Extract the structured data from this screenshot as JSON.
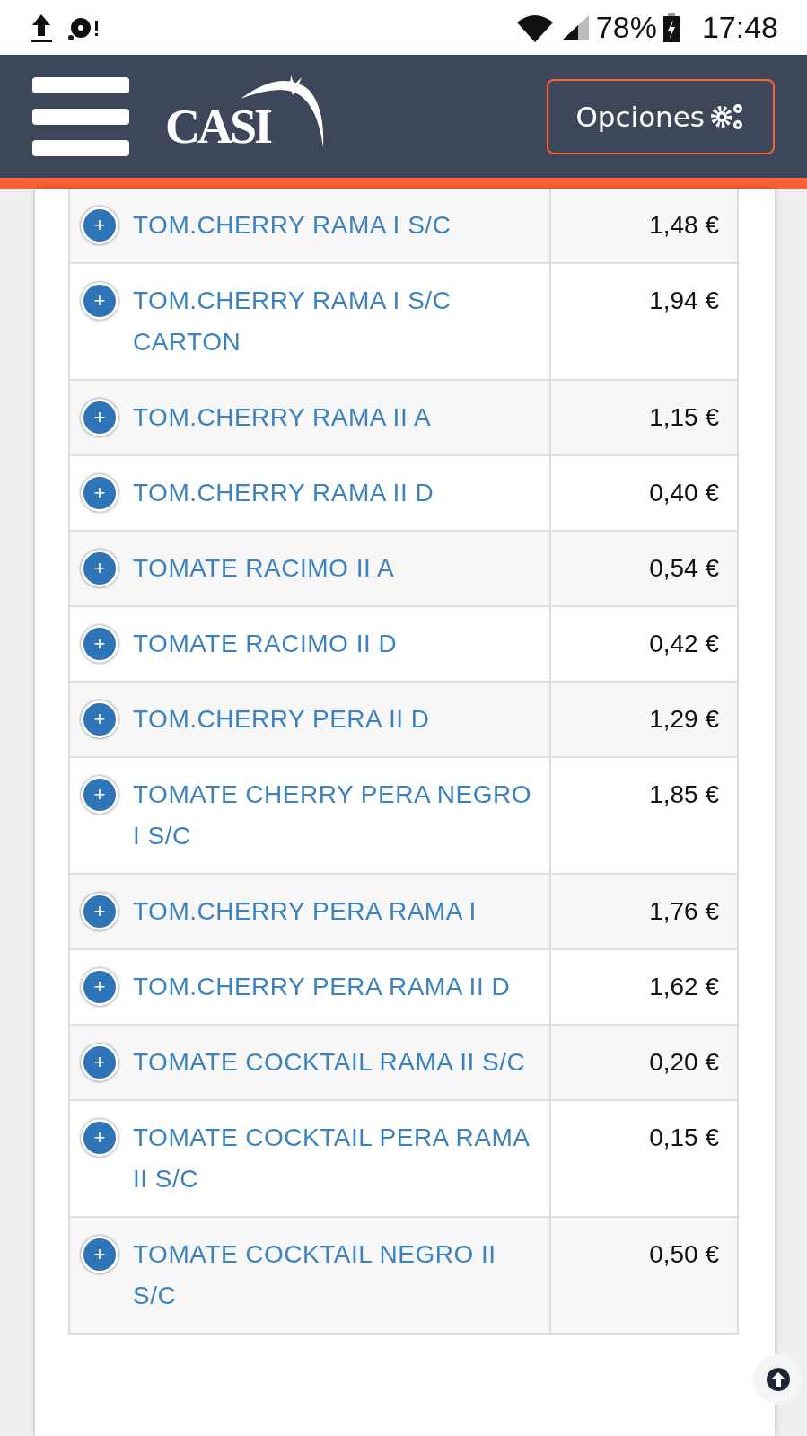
{
  "status_bar": {
    "battery": "78%",
    "time": "17:48"
  },
  "header": {
    "logo": "CASI",
    "options_button": "Opciones"
  },
  "rows": [
    {
      "icon": "+",
      "name": "TOM.CHERRY RAMA I S/C",
      "price": "1,48 €"
    },
    {
      "icon": "+",
      "name": "TOM.CHERRY RAMA I S/C CARTON",
      "price": "1,94 €"
    },
    {
      "icon": "+",
      "name": "TOM.CHERRY RAMA II A",
      "price": "1,15 €"
    },
    {
      "icon": "+",
      "name": "TOM.CHERRY RAMA II D",
      "price": "0,40 €"
    },
    {
      "icon": "+",
      "name": "TOMATE RACIMO II A",
      "price": "0,54 €"
    },
    {
      "icon": "+",
      "name": "TOMATE RACIMO II D",
      "price": "0,42 €"
    },
    {
      "icon": "+",
      "name": "TOM.CHERRY PERA II D",
      "price": "1,29 €"
    },
    {
      "icon": "+",
      "name": "TOMATE CHERRY PERA NEGRO I S/C",
      "price": "1,85 €"
    },
    {
      "icon": "+",
      "name": "TOM.CHERRY PERA RAMA I",
      "price": "1,76 €"
    },
    {
      "icon": "+",
      "name": "TOM.CHERRY PERA RAMA II D",
      "price": "1,62 €"
    },
    {
      "icon": "+",
      "name": "TOMATE COCKTAIL RAMA II S/C",
      "price": "0,20 €"
    },
    {
      "icon": "+",
      "name": "TOMATE COCKTAIL PERA RAMA II S/C",
      "price": "0,15 €"
    },
    {
      "icon": "+",
      "name": "TOMATE COCKTAIL NEGRO II S/C",
      "price": "0,50 €"
    }
  ]
}
